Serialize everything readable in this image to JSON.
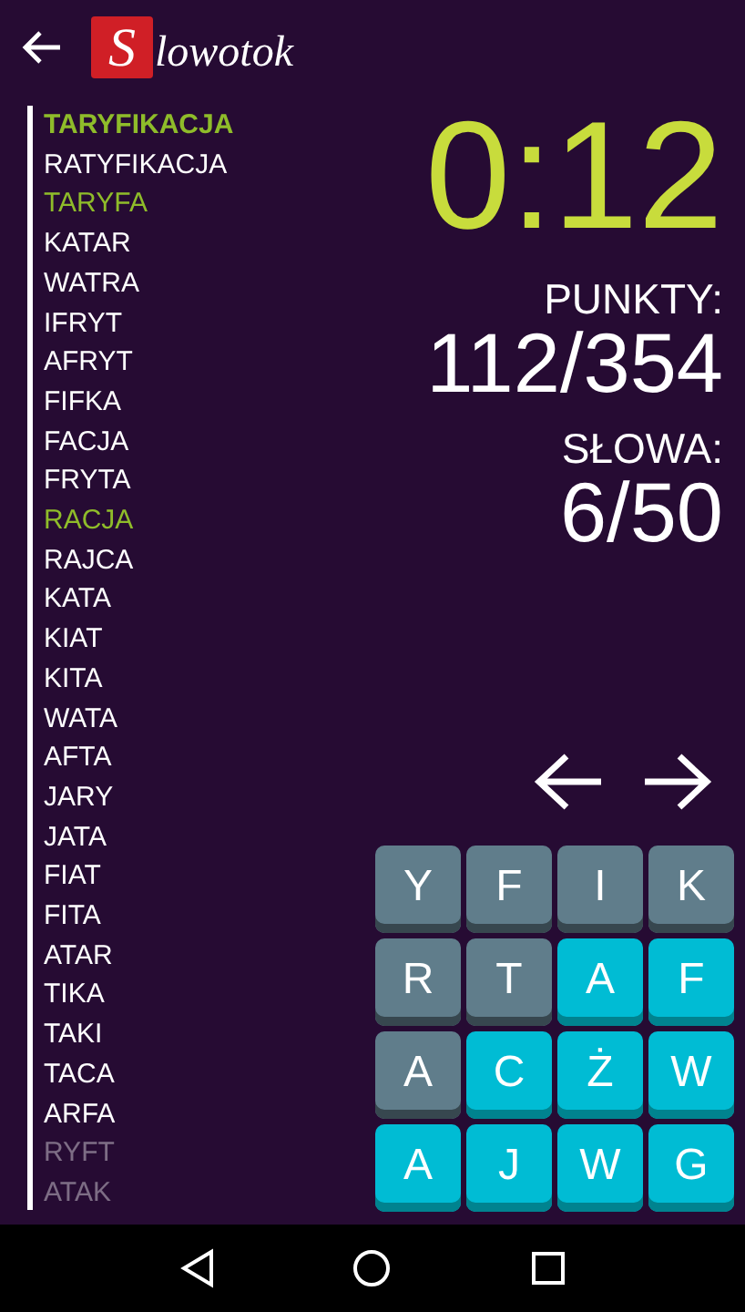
{
  "header": {
    "logo_initial": "S",
    "logo_rest": "lowotok"
  },
  "words": [
    {
      "text": "TARYFIKACJA",
      "kind": "best",
      "faded": false
    },
    {
      "text": "RATYFIKACJA",
      "kind": "normal",
      "faded": false
    },
    {
      "text": "TARYFA",
      "kind": "found",
      "faded": false
    },
    {
      "text": "KATAR",
      "kind": "normal",
      "faded": false
    },
    {
      "text": "WATRA",
      "kind": "normal",
      "faded": false
    },
    {
      "text": "IFRYT",
      "kind": "normal",
      "faded": false
    },
    {
      "text": "AFRYT",
      "kind": "normal",
      "faded": false
    },
    {
      "text": "FIFKA",
      "kind": "normal",
      "faded": false
    },
    {
      "text": "FACJA",
      "kind": "normal",
      "faded": false
    },
    {
      "text": "FRYTA",
      "kind": "normal",
      "faded": false
    },
    {
      "text": "RACJA",
      "kind": "found",
      "faded": false
    },
    {
      "text": "RAJCA",
      "kind": "normal",
      "faded": false
    },
    {
      "text": "KATA",
      "kind": "normal",
      "faded": false
    },
    {
      "text": "KIAT",
      "kind": "normal",
      "faded": false
    },
    {
      "text": "KITA",
      "kind": "normal",
      "faded": false
    },
    {
      "text": "WATA",
      "kind": "normal",
      "faded": false
    },
    {
      "text": "AFTA",
      "kind": "normal",
      "faded": false
    },
    {
      "text": "JARY",
      "kind": "normal",
      "faded": false
    },
    {
      "text": "JATA",
      "kind": "normal",
      "faded": false
    },
    {
      "text": "FIAT",
      "kind": "normal",
      "faded": false
    },
    {
      "text": "FITA",
      "kind": "normal",
      "faded": false
    },
    {
      "text": "ATAR",
      "kind": "normal",
      "faded": false
    },
    {
      "text": "TIKA",
      "kind": "normal",
      "faded": false
    },
    {
      "text": "TAKI",
      "kind": "normal",
      "faded": false
    },
    {
      "text": "TACA",
      "kind": "normal",
      "faded": false
    },
    {
      "text": "ARFA",
      "kind": "normal",
      "faded": false
    },
    {
      "text": "RYFT",
      "kind": "normal",
      "faded": true
    },
    {
      "text": "ATAK",
      "kind": "normal",
      "faded": true
    }
  ],
  "timer": "0:12",
  "points": {
    "label": "PUNKTY:",
    "value": "112/354"
  },
  "words_count": {
    "label": "SŁOWA:",
    "value": "6/50"
  },
  "tiles": [
    {
      "letter": "Y",
      "selected": false
    },
    {
      "letter": "F",
      "selected": false
    },
    {
      "letter": "I",
      "selected": false
    },
    {
      "letter": "K",
      "selected": false
    },
    {
      "letter": "R",
      "selected": false
    },
    {
      "letter": "T",
      "selected": false
    },
    {
      "letter": "A",
      "selected": true
    },
    {
      "letter": "F",
      "selected": true
    },
    {
      "letter": "A",
      "selected": false
    },
    {
      "letter": "C",
      "selected": true
    },
    {
      "letter": "Ż",
      "selected": true
    },
    {
      "letter": "W",
      "selected": true
    },
    {
      "letter": "A",
      "selected": true
    },
    {
      "letter": "J",
      "selected": true
    },
    {
      "letter": "W",
      "selected": true
    },
    {
      "letter": "G",
      "selected": true
    }
  ]
}
